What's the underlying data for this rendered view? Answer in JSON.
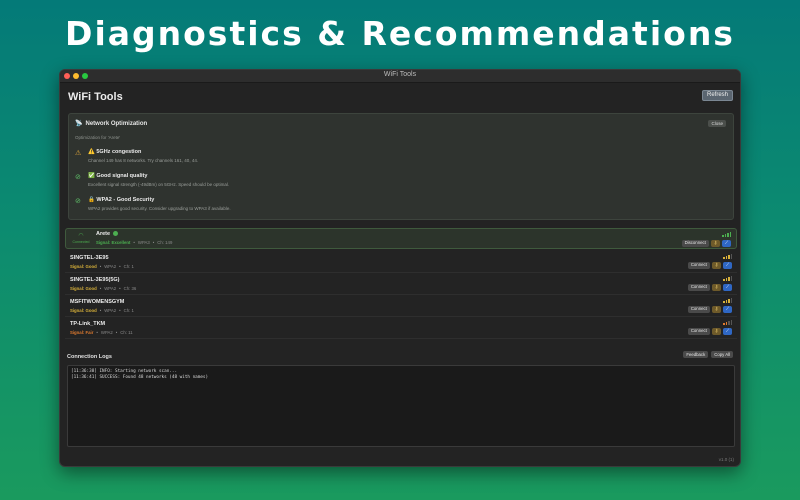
{
  "headline": "Diagnostics & Recommendations",
  "window": {
    "title": "WiFi Tools"
  },
  "app": {
    "title": "WiFi Tools",
    "refresh_label": "Refresh"
  },
  "optimization": {
    "title": "Network Optimization",
    "title_icon": "satellite-icon",
    "close_label": "Close",
    "subtitle": "Optimization for 'Arete'",
    "recommendations": [
      {
        "status": "warning",
        "title": "⚠️ 5GHz congestion",
        "description": "Channel 149 has 8 networks. Try channels 161, 40, 44."
      },
      {
        "status": "ok",
        "title": "✅ Good signal quality",
        "description": "Excellent signal strength (-49dBm) on 5GHz. Speed should be optimal."
      },
      {
        "status": "ok",
        "title": "🔒 WPA2 - Good Security",
        "description": "WPA2 provides good security. Consider upgrading to WPA3 if available."
      }
    ]
  },
  "networks": [
    {
      "name": "Arete",
      "connected": true,
      "connected_label": "Connected",
      "signal": "Signal: Excellent",
      "signal_level": "excellent",
      "bars": 4,
      "security": "WPA3",
      "channel": "Ch: 149",
      "action": "Disconnect"
    },
    {
      "name": "SINGTEL-3E95",
      "connected": false,
      "signal": "Signal: Good",
      "signal_level": "good",
      "bars": 3,
      "security": "WPA2",
      "channel": "Ch: 1",
      "action": "Connect"
    },
    {
      "name": "SINGTEL-3E95(5G)",
      "connected": false,
      "signal": "Signal: Good",
      "signal_level": "good",
      "bars": 3,
      "security": "WPA2",
      "channel": "Ch: 36",
      "action": "Connect"
    },
    {
      "name": "MSFITWOMENSGYM",
      "connected": false,
      "signal": "Signal: Good",
      "signal_level": "good",
      "bars": 3,
      "security": "WPA2",
      "channel": "Ch: 1",
      "action": "Connect"
    },
    {
      "name": "TP-Link_TKM",
      "connected": false,
      "signal": "Signal: Fair",
      "signal_level": "fair",
      "bars": 2,
      "security": "WPA2",
      "channel": "Ch: 11",
      "action": "Connect"
    }
  ],
  "logs": {
    "title": "Connection Logs",
    "feedback_label": "Feedback",
    "copy_label": "Copy All",
    "lines": [
      "[11:36:38] INFO: Starting network scan...",
      "[11:36:41] SUCCESS: Found 48 networks (48 with names)"
    ]
  },
  "version": "v1.0 (1)",
  "colors": {
    "bg_top": "#047a78",
    "bg_bottom": "#1a9a5e",
    "signal_excellent": "#4caf50",
    "signal_good": "#d9b23a",
    "signal_fair": "#e07b2f",
    "accent_blue": "#2f67c4"
  }
}
